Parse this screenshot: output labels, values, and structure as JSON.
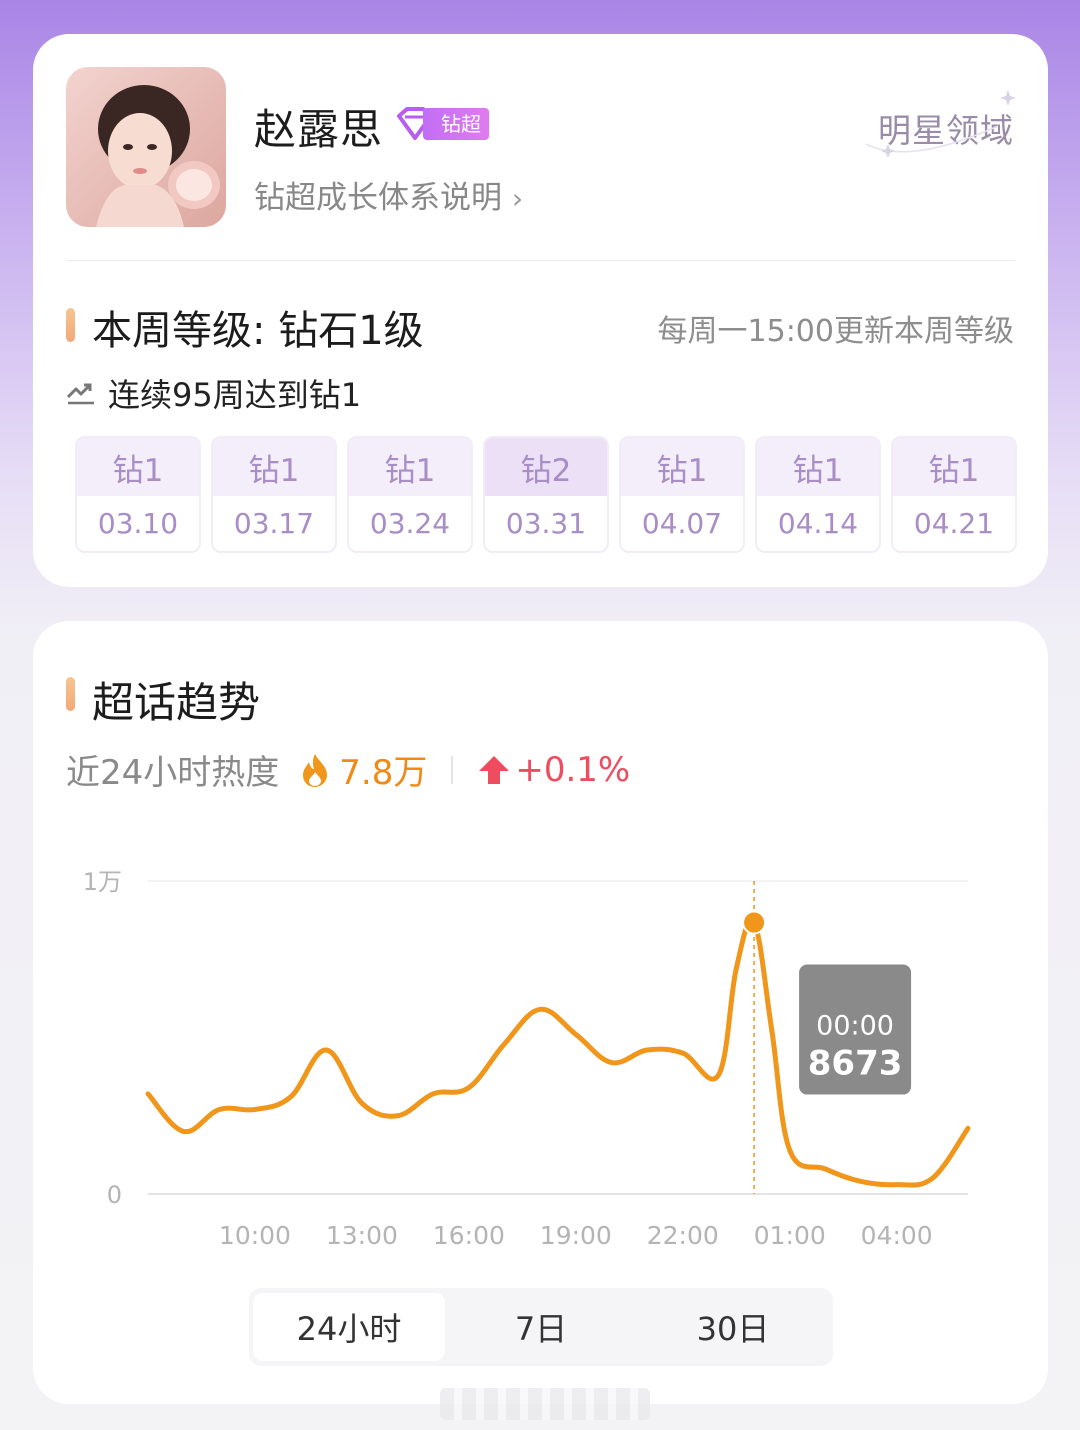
{
  "profile": {
    "name": "赵露思",
    "badge": "钻超",
    "growth_link": "钻超成长体系说明",
    "domain": "明星领域"
  },
  "level": {
    "title": "本周等级: 钻石1级",
    "update_note": "每周一15:00更新本周等级",
    "streak": "连续95周达到钻1",
    "weeks": [
      {
        "level": "钻1",
        "date": "03.10"
      },
      {
        "level": "钻1",
        "date": "03.17"
      },
      {
        "level": "钻1",
        "date": "03.24"
      },
      {
        "level": "钻2",
        "date": "03.31"
      },
      {
        "level": "钻1",
        "date": "04.07"
      },
      {
        "level": "钻1",
        "date": "04.14"
      },
      {
        "level": "钻1",
        "date": "04.21"
      }
    ]
  },
  "trend": {
    "title": "超话趋势",
    "heat_label": "近24小时热度",
    "heat_value": "7.8万",
    "heat_change": "+0.1%",
    "tooltip": {
      "time": "00:00",
      "value": "8673"
    },
    "tabs": [
      "24小时",
      "7日",
      "30日"
    ],
    "active_tab": "24小时"
  },
  "colors": {
    "line": "#f0961a",
    "accent_bar": "#f3a878",
    "up": "#ef4d5f"
  },
  "chart_data": {
    "type": "line",
    "ylim": [
      0,
      10000
    ],
    "y_tick_labels": [
      "0",
      "1万"
    ],
    "x_tick_labels": [
      "10:00",
      "13:00",
      "16:00",
      "19:00",
      "22:00",
      "01:00",
      "04:00"
    ],
    "x_hours": [
      7,
      8,
      9,
      10,
      11,
      12,
      13,
      14,
      15,
      16,
      17,
      18,
      19,
      20,
      21,
      22,
      23,
      23.5,
      24,
      24.5,
      25,
      26,
      27,
      28,
      29,
      30
    ],
    "values": [
      3200,
      2000,
      2700,
      2700,
      3100,
      4600,
      2900,
      2500,
      3200,
      3400,
      4800,
      5900,
      5100,
      4200,
      4600,
      4500,
      3800,
      7200,
      8673,
      5200,
      1400,
      800,
      400,
      300,
      500,
      2100
    ],
    "highlight": {
      "x_hour": 24,
      "value": 8673,
      "label": "00:00"
    }
  }
}
